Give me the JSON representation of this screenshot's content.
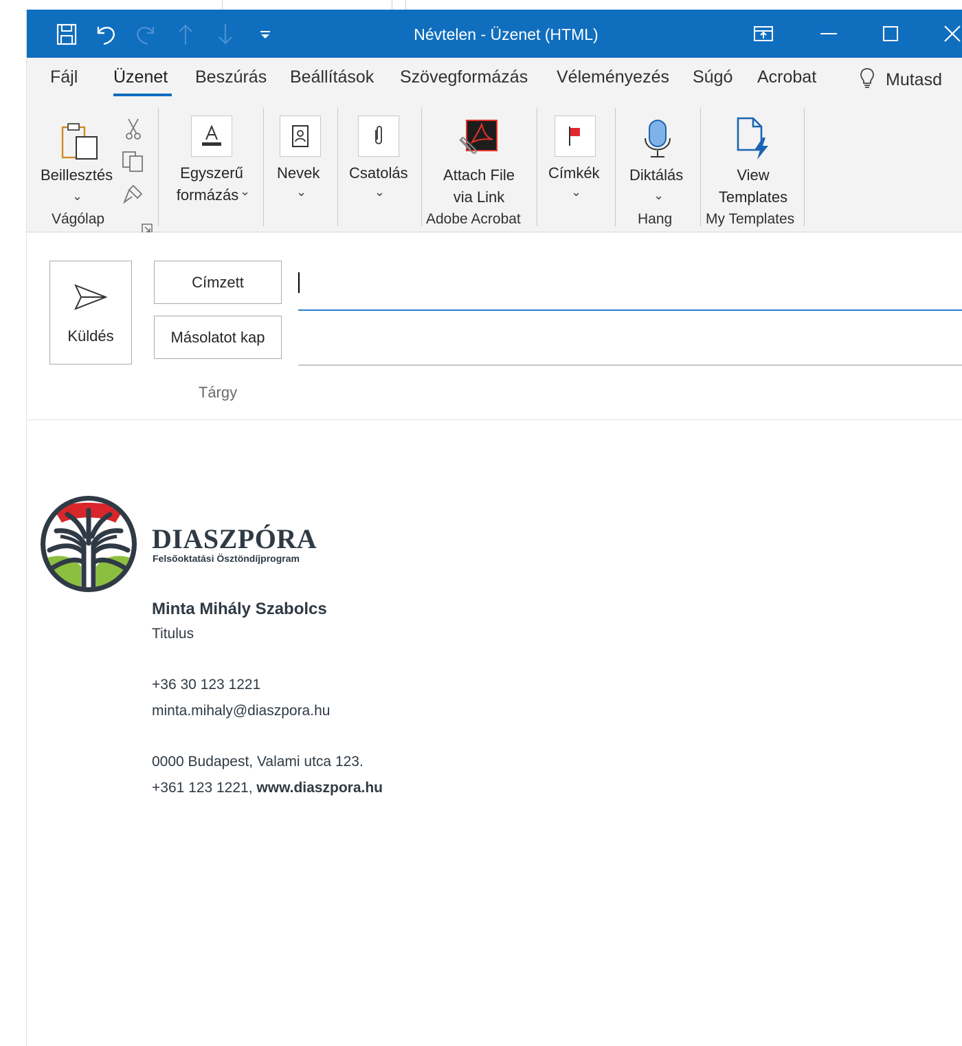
{
  "window": {
    "title": "Névtelen  -  Üzenet (HTML)"
  },
  "qat": {
    "icons": [
      "save-icon",
      "undo-icon",
      "redo-icon",
      "up-arrow-icon",
      "down-arrow-icon",
      "customize-qat-icon"
    ]
  },
  "tabs": [
    {
      "label": "Fájl"
    },
    {
      "label": "Üzenet",
      "active": true
    },
    {
      "label": "Beszúrás"
    },
    {
      "label": "Beállítások"
    },
    {
      "label": "Szövegformázás"
    },
    {
      "label": "Véleményezés"
    },
    {
      "label": "Súgó"
    },
    {
      "label": "Acrobat"
    }
  ],
  "tellme": {
    "label": "Mutasd"
  },
  "ribbon": {
    "clipboard": {
      "paste": "Beillesztés",
      "group": "Vágólap"
    },
    "basic_text": {
      "line1": "Egyszerű",
      "line2": "formázás"
    },
    "names": {
      "label": "Nevek"
    },
    "attach": {
      "label": "Csatolás"
    },
    "acrobat": {
      "line1": "Attach File",
      "line2": "via Link",
      "group": "Adobe Acrobat"
    },
    "tags": {
      "label": "Címkék"
    },
    "voice": {
      "label": "Diktálás",
      "group": "Hang"
    },
    "templates": {
      "line1": "View",
      "line2": "Templates",
      "group": "My Templates"
    }
  },
  "compose": {
    "send": "Küldés",
    "to": "Címzett",
    "cc": "Másolatot kap",
    "subject": "Tárgy",
    "to_value": "",
    "cc_value": ""
  },
  "signature": {
    "brand": "DIASZPÓRA",
    "brand_sub": "Felsőoktatási Ösztöndíjprogram",
    "name": "Minta Mihály Szabolcs",
    "title": "Titulus",
    "phone": "+36 30 123 1221",
    "email": "minta.mihaly@diaszpora.hu",
    "address": "0000 Budapest, Valami utca 123.",
    "office_phone": "+361 123 1221, ",
    "website": "www.diaszpora.hu"
  },
  "colors": {
    "titlebar": "#106ebe",
    "ribbon_bg": "#f3f3f3",
    "accent": "#106ebe",
    "logo_dark": "#2f3a44",
    "logo_red": "#d9262b",
    "logo_green": "#8cbf3f"
  }
}
